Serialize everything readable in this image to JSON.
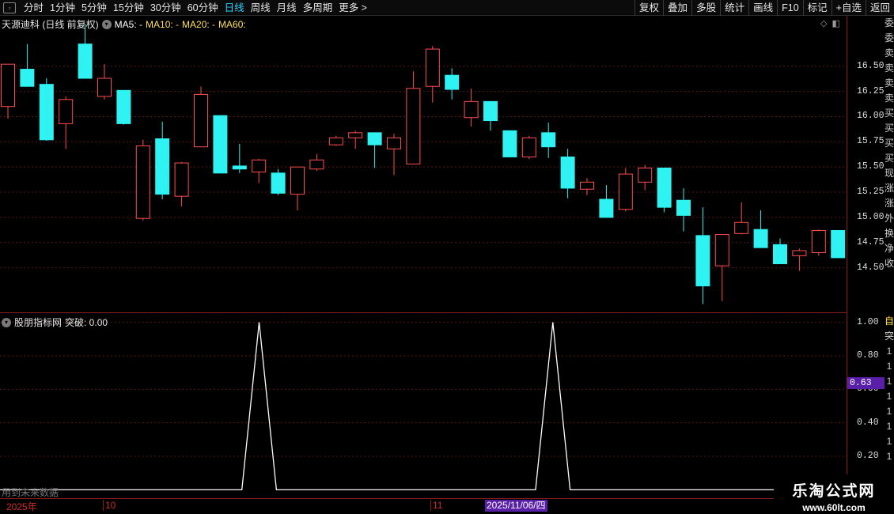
{
  "toolbar": {
    "left_items": [
      {
        "label": "分时",
        "active": false
      },
      {
        "label": "1分钟",
        "active": false
      },
      {
        "label": "5分钟",
        "active": false
      },
      {
        "label": "15分钟",
        "active": false
      },
      {
        "label": "30分钟",
        "active": false
      },
      {
        "label": "60分钟",
        "active": false
      },
      {
        "label": "日线",
        "active": true
      },
      {
        "label": "周线",
        "active": false
      },
      {
        "label": "月线",
        "active": false
      },
      {
        "label": "多周期",
        "active": false
      },
      {
        "label": "更多 >",
        "active": false
      }
    ],
    "right_items": [
      "复权",
      "叠加",
      "多股",
      "统计",
      "画线",
      "F10",
      "标记",
      "+自选",
      "返回"
    ]
  },
  "main_chart": {
    "stock_title": "天源迪科 (日线 前复权)",
    "ma5_label": "MA5: -",
    "ma10_label": "MA10: -",
    "ma20_label": "MA20: -",
    "ma60_label": "MA60:",
    "y_ticks": [
      "16.50",
      "16.25",
      "16.00",
      "15.75",
      "15.50",
      "15.25",
      "15.00",
      "14.75",
      "14.50"
    ],
    "colors": {
      "up": "#ff4d4d",
      "down": "#2ff2f2"
    }
  },
  "chart_data": [
    {
      "type": "candlestick",
      "title": "天源迪科 (日线 前复权)",
      "ylim": [
        14.05,
        17.0
      ],
      "series": [
        {
          "o": 16.1,
          "h": 16.52,
          "l": 15.98,
          "c": 16.52
        },
        {
          "o": 16.47,
          "h": 16.72,
          "l": 16.3,
          "c": 16.3
        },
        {
          "o": 16.32,
          "h": 16.38,
          "l": 15.76,
          "c": 15.77
        },
        {
          "o": 15.93,
          "h": 16.2,
          "l": 15.68,
          "c": 16.17
        },
        {
          "o": 16.72,
          "h": 16.92,
          "l": 16.38,
          "c": 16.38
        },
        {
          "o": 16.2,
          "h": 16.52,
          "l": 16.17,
          "c": 16.38
        },
        {
          "o": 16.26,
          "h": 16.26,
          "l": 15.92,
          "c": 15.93
        },
        {
          "o": 14.99,
          "h": 15.77,
          "l": 14.97,
          "c": 15.71
        },
        {
          "o": 15.78,
          "h": 15.95,
          "l": 15.18,
          "c": 15.23
        },
        {
          "o": 15.21,
          "h": 15.55,
          "l": 15.11,
          "c": 15.54
        },
        {
          "o": 15.7,
          "h": 16.3,
          "l": 15.7,
          "c": 16.22
        },
        {
          "o": 16.01,
          "h": 16.01,
          "l": 15.44,
          "c": 15.44
        },
        {
          "o": 15.51,
          "h": 15.73,
          "l": 15.44,
          "c": 15.48
        },
        {
          "o": 15.45,
          "h": 15.58,
          "l": 15.34,
          "c": 15.57
        },
        {
          "o": 15.44,
          "h": 15.48,
          "l": 15.22,
          "c": 15.24
        },
        {
          "o": 15.23,
          "h": 15.5,
          "l": 15.07,
          "c": 15.5
        },
        {
          "o": 15.48,
          "h": 15.63,
          "l": 15.46,
          "c": 15.57
        },
        {
          "o": 15.72,
          "h": 15.81,
          "l": 15.71,
          "c": 15.79
        },
        {
          "o": 15.79,
          "h": 15.86,
          "l": 15.68,
          "c": 15.84
        },
        {
          "o": 15.84,
          "h": 15.84,
          "l": 15.49,
          "c": 15.72
        },
        {
          "o": 15.68,
          "h": 15.83,
          "l": 15.42,
          "c": 15.79
        },
        {
          "o": 15.53,
          "h": 16.45,
          "l": 15.53,
          "c": 16.28
        },
        {
          "o": 16.3,
          "h": 16.7,
          "l": 16.14,
          "c": 16.67
        },
        {
          "o": 16.41,
          "h": 16.48,
          "l": 16.17,
          "c": 16.27
        },
        {
          "o": 15.99,
          "h": 16.28,
          "l": 15.9,
          "c": 16.15
        },
        {
          "o": 16.15,
          "h": 16.15,
          "l": 15.86,
          "c": 15.96
        },
        {
          "o": 15.86,
          "h": 15.86,
          "l": 15.6,
          "c": 15.6
        },
        {
          "o": 15.6,
          "h": 15.81,
          "l": 15.58,
          "c": 15.79
        },
        {
          "o": 15.84,
          "h": 15.94,
          "l": 15.59,
          "c": 15.7
        },
        {
          "o": 15.6,
          "h": 15.68,
          "l": 15.19,
          "c": 15.29
        },
        {
          "o": 15.28,
          "h": 15.39,
          "l": 15.22,
          "c": 15.35
        },
        {
          "o": 15.18,
          "h": 15.32,
          "l": 15.0,
          "c": 15.0
        },
        {
          "o": 15.08,
          "h": 15.49,
          "l": 15.06,
          "c": 15.43
        },
        {
          "o": 15.35,
          "h": 15.52,
          "l": 15.27,
          "c": 15.49
        },
        {
          "o": 15.49,
          "h": 15.49,
          "l": 15.05,
          "c": 15.1
        },
        {
          "o": 15.17,
          "h": 15.29,
          "l": 14.86,
          "c": 15.02
        },
        {
          "o": 14.82,
          "h": 15.1,
          "l": 14.14,
          "c": 14.32
        },
        {
          "o": 14.52,
          "h": 14.83,
          "l": 14.17,
          "c": 14.83
        },
        {
          "o": 14.84,
          "h": 15.15,
          "l": 14.83,
          "c": 14.95
        },
        {
          "o": 14.88,
          "h": 15.07,
          "l": 14.71,
          "c": 14.7
        },
        {
          "o": 14.73,
          "h": 14.79,
          "l": 14.54,
          "c": 14.54
        },
        {
          "o": 14.62,
          "h": 14.69,
          "l": 14.47,
          "c": 14.67
        },
        {
          "o": 14.65,
          "h": 14.88,
          "l": 14.62,
          "c": 14.87
        },
        {
          "o": 14.87,
          "h": 14.87,
          "l": 14.6,
          "c": 14.6
        }
      ]
    },
    {
      "type": "line",
      "title": "股朋指标网",
      "ylim": [
        -0.05,
        1.05
      ],
      "series": [
        {
          "name": "突破",
          "values": [
            0,
            0,
            0,
            0,
            0,
            0,
            0,
            0,
            0,
            0,
            0,
            0,
            0,
            0,
            0,
            1,
            0,
            0,
            0,
            0,
            0,
            0,
            0,
            0,
            0,
            0,
            0,
            0,
            0,
            0,
            0,
            0,
            1,
            0,
            0,
            0,
            0,
            0,
            0,
            0,
            0,
            0,
            0,
            0,
            0,
            0,
            0,
            0,
            0,
            0
          ]
        }
      ],
      "y_ticks": [
        "1.00",
        "0.80",
        "0.60",
        "0.40",
        "0.20"
      ],
      "line_color": "#ffffff"
    }
  ],
  "indicator": {
    "name": "股朋指标网",
    "value_label": "突破: 0.00",
    "cursor_value": "0.63"
  },
  "footer": {
    "notice": "用到未来数据",
    "year_label": "2025年",
    "month_oct": "10",
    "month_nov": "11",
    "cursor_date": "2025/11/06/四"
  },
  "side_strip_chars": [
    "委",
    "委",
    "卖",
    "卖",
    "卖",
    "卖",
    "买",
    "买",
    "买",
    "买",
    "现",
    "涨",
    "涨",
    "外",
    "换",
    "净",
    "收"
  ],
  "side_strip_ind_chars": [
    "自",
    "突",
    "1",
    "1",
    "1",
    "1",
    "1",
    "1",
    "1",
    "1"
  ],
  "logo": {
    "title": "乐淘公式网",
    "url": "www.60lt.com"
  }
}
